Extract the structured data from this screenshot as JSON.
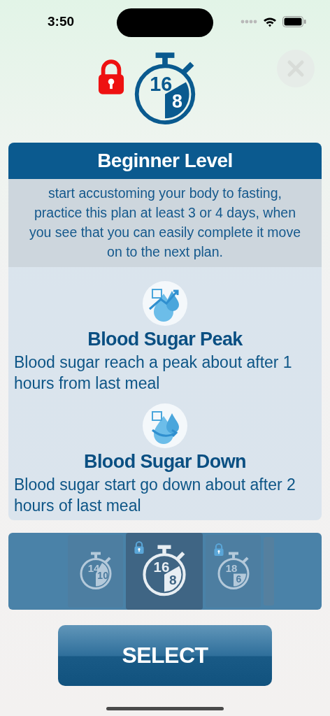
{
  "status_bar": {
    "time": "3:50"
  },
  "header": {
    "locked": true,
    "plan": {
      "fasting": "16",
      "eating": "8"
    }
  },
  "level_card": {
    "title": "Beginner Level",
    "description": "start accustoming your body to fasting, practice this plan at least 3 or 4 days, when you see that you can easily complete it move on to the next plan.",
    "sections": [
      {
        "kind": "peak",
        "title": "Blood Sugar Peak",
        "text": "Blood sugar reach a peak about after 1 hours from last meal"
      },
      {
        "kind": "down",
        "title": "Blood Sugar Down",
        "text": "Blood sugar start go down about after 2 hours of last meal"
      }
    ]
  },
  "plans": [
    {
      "fasting": "14",
      "eating": "10",
      "locked": false,
      "selected": false
    },
    {
      "fasting": "16",
      "eating": "8",
      "locked": true,
      "selected": true
    },
    {
      "fasting": "18",
      "eating": "6",
      "locked": true,
      "selected": false
    }
  ],
  "select_button": "SELECT"
}
